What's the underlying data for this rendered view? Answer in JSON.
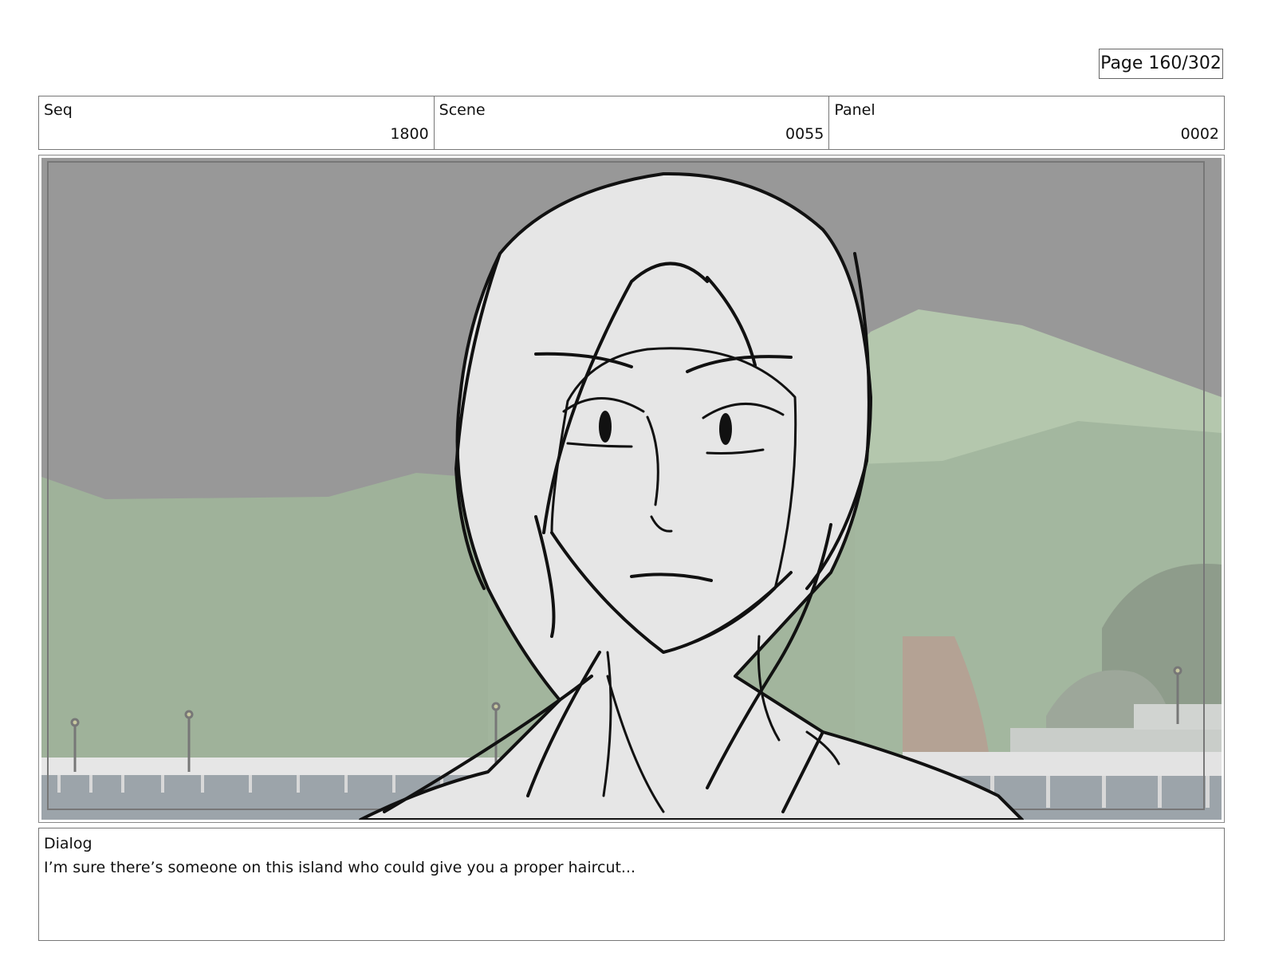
{
  "page": {
    "label": "Page 160/302"
  },
  "header": {
    "seq": {
      "label": "Seq",
      "value": "1800"
    },
    "scene": {
      "label": "Scene",
      "value": "0055"
    },
    "panel": {
      "label": "Panel",
      "value": "0002"
    }
  },
  "dialog": {
    "label": "Dialog",
    "text": "I’m sure there’s someone on this island who could give you a proper haircut..."
  },
  "colors": {
    "sky": "#989898",
    "hills": "#9fb29a",
    "hill_light": "#b4c7ad",
    "water": "#9ca4aa",
    "pier": "#e6e6e6",
    "sketch_fill": "#e6e6e6",
    "ink": "#111111"
  }
}
